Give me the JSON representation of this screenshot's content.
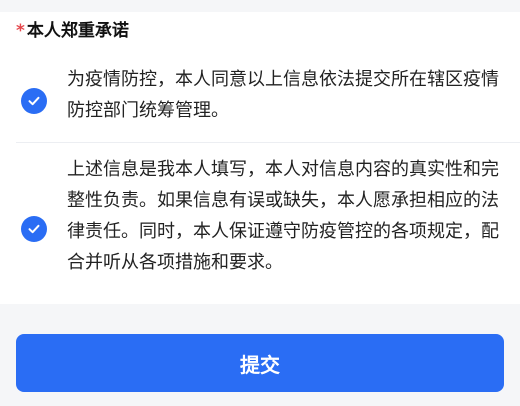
{
  "promise": {
    "required_mark": "*",
    "title": "本人郑重承诺",
    "items": [
      {
        "checked": true,
        "icon": "checkmark-circle",
        "text": "为疫情防控，本人同意以上信息依法提交所在辖区疫情防控部门统筹管理。"
      },
      {
        "checked": true,
        "icon": "checkmark-circle",
        "text": "上述信息是我本人填写，本人对信息内容的真实性和完整性负责。如果信息有误或缺失，本人愿承担相应的法律责任。同时，本人保证遵守防疫管控的各项规定，配合并听从各项措施和要求。"
      }
    ]
  },
  "submit": {
    "label": "提交"
  },
  "colors": {
    "accent": "#2a6df4",
    "required": "#e5484d",
    "background": "#f5f6f8"
  }
}
